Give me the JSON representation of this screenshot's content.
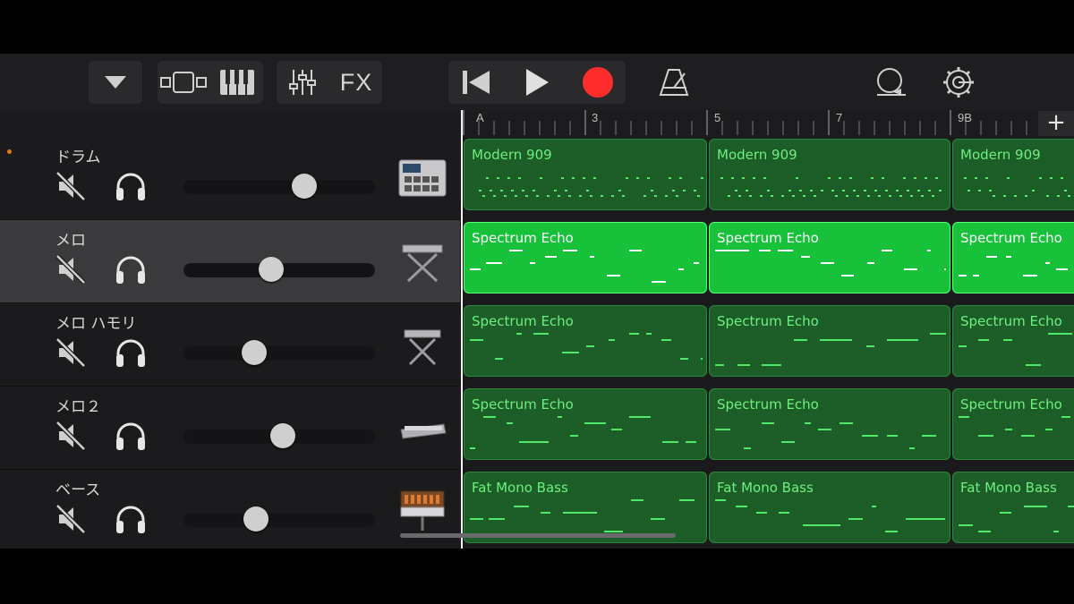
{
  "toolbar": {
    "fx_label": "FX",
    "icons": [
      "dropdown-triangle-icon",
      "tracks-view-icon",
      "keyboard-icon",
      "mixer-icon",
      "rewind-icon",
      "play-icon",
      "record-icon",
      "metronome-icon",
      "loop-icon",
      "settings-gear-icon"
    ],
    "record_color": "#ff2d2d"
  },
  "ruler": {
    "bars": [
      "A",
      "3",
      "5",
      "7",
      "9B"
    ]
  },
  "tracks": [
    {
      "name": "ドラム",
      "volume": 0.63,
      "instrument": "drum-machine-icon"
    },
    {
      "name": "メロ",
      "volume": 0.46,
      "instrument": "keyboard-stand-icon",
      "selected": true
    },
    {
      "name": "メロ ハモリ",
      "volume": 0.37,
      "instrument": "keyboard-stand-icon"
    },
    {
      "name": "メロ２",
      "volume": 0.52,
      "instrument": "synth-icon"
    },
    {
      "name": "ベース",
      "volume": 0.38,
      "instrument": "bass-synth-icon"
    }
  ],
  "regions": [
    {
      "track": 0,
      "names": [
        "Modern 909",
        "Modern 909",
        "Modern 909"
      ]
    },
    {
      "track": 1,
      "names": [
        "Spectrum Echo",
        "Spectrum Echo",
        "Spectrum Echo"
      ],
      "selected": true
    },
    {
      "track": 2,
      "names": [
        "Spectrum Echo",
        "Spectrum Echo",
        "Spectrum Echo"
      ]
    },
    {
      "track": 3,
      "names": [
        "Spectrum Echo",
        "Spectrum Echo",
        "Spectrum Echo"
      ]
    },
    {
      "track": 4,
      "names": [
        "Fat Mono Bass",
        "Fat Mono Bass",
        "Fat Mono Bass"
      ]
    }
  ],
  "colors": {
    "region": "#1d5d28",
    "region_selected": "#17c23a",
    "note": "#4fe868"
  }
}
